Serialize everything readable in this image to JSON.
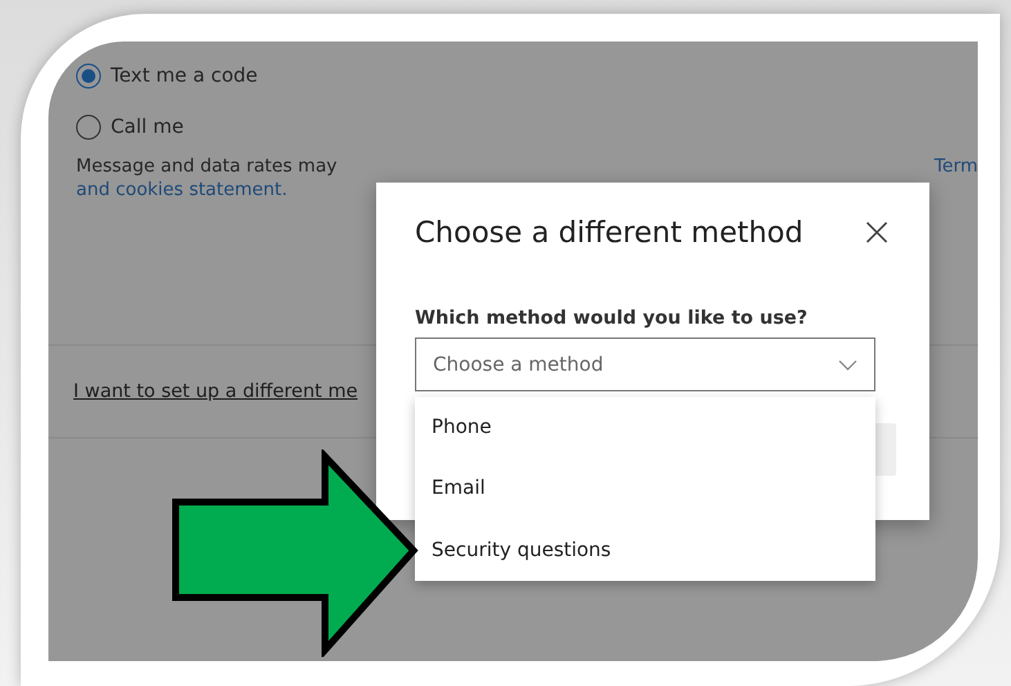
{
  "options": [
    {
      "label": "Text me a code",
      "selected": true
    },
    {
      "label": "Call me",
      "selected": false
    }
  ],
  "disclaimer": {
    "text": "Message and data rates may",
    "link": "Term",
    "link_continued": "and cookies statement."
  },
  "alternate_link": "I want to set up a different me",
  "dialog": {
    "title": "Choose a different method",
    "field_label": "Which method would you like to use?",
    "select": {
      "placeholder": "Choose a method",
      "expanded": true
    },
    "menu_items": [
      {
        "label": "Phone"
      },
      {
        "label": "Email"
      },
      {
        "label": "Security questions"
      }
    ]
  }
}
